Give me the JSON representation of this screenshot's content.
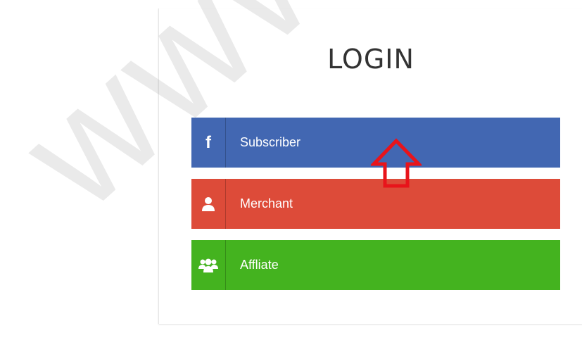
{
  "login": {
    "title": "LOGIN",
    "buttons": [
      {
        "label": "Subscriber",
        "icon": "facebook-icon",
        "color": "#4267b2"
      },
      {
        "label": "Merchant",
        "icon": "user-icon",
        "color": "#dd4b39"
      },
      {
        "label": "Affliate",
        "icon": "users-group-icon",
        "color": "#44b31f"
      }
    ]
  },
  "colors": {
    "annotation_arrow": "#e8141b"
  }
}
